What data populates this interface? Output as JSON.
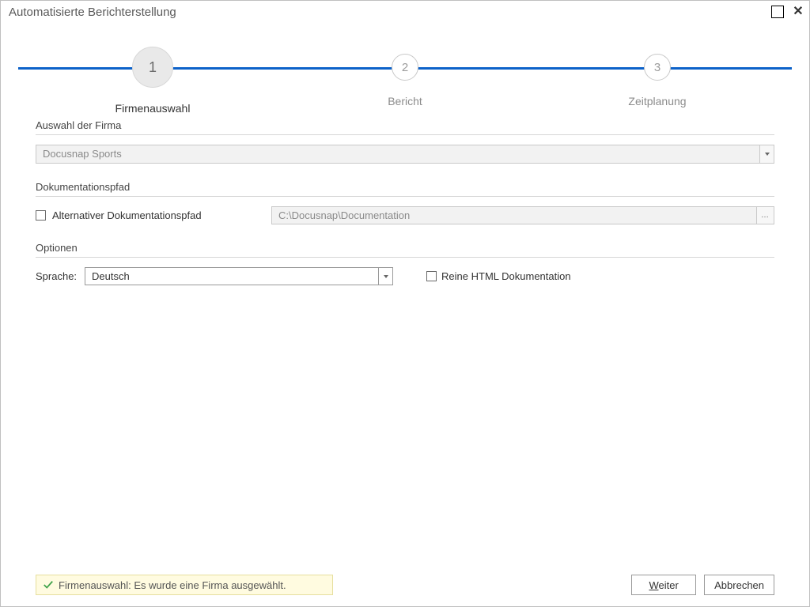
{
  "window": {
    "title": "Automatisierte Berichterstellung"
  },
  "stepper": {
    "steps": [
      {
        "number": "1",
        "label": "Firmenauswahl",
        "active": true
      },
      {
        "number": "2",
        "label": "Bericht",
        "active": false
      },
      {
        "number": "3",
        "label": "Zeitplanung",
        "active": false
      }
    ]
  },
  "sections": {
    "company": {
      "title": "Auswahl der Firma",
      "selected": "Docusnap Sports"
    },
    "docpath": {
      "title": "Dokumentationspfad",
      "checkbox_label": "Alternativer Dokumentationspfad",
      "path_value": "C:\\Docusnap\\Documentation"
    },
    "options": {
      "title": "Optionen",
      "language_label": "Sprache:",
      "language_value": "Deutsch",
      "html_checkbox_label": "Reine HTML Dokumentation"
    }
  },
  "footer": {
    "status": "Firmenauswahl: Es wurde eine Firma ausgewählt.",
    "next": "Weiter",
    "cancel": "Abbrechen"
  }
}
